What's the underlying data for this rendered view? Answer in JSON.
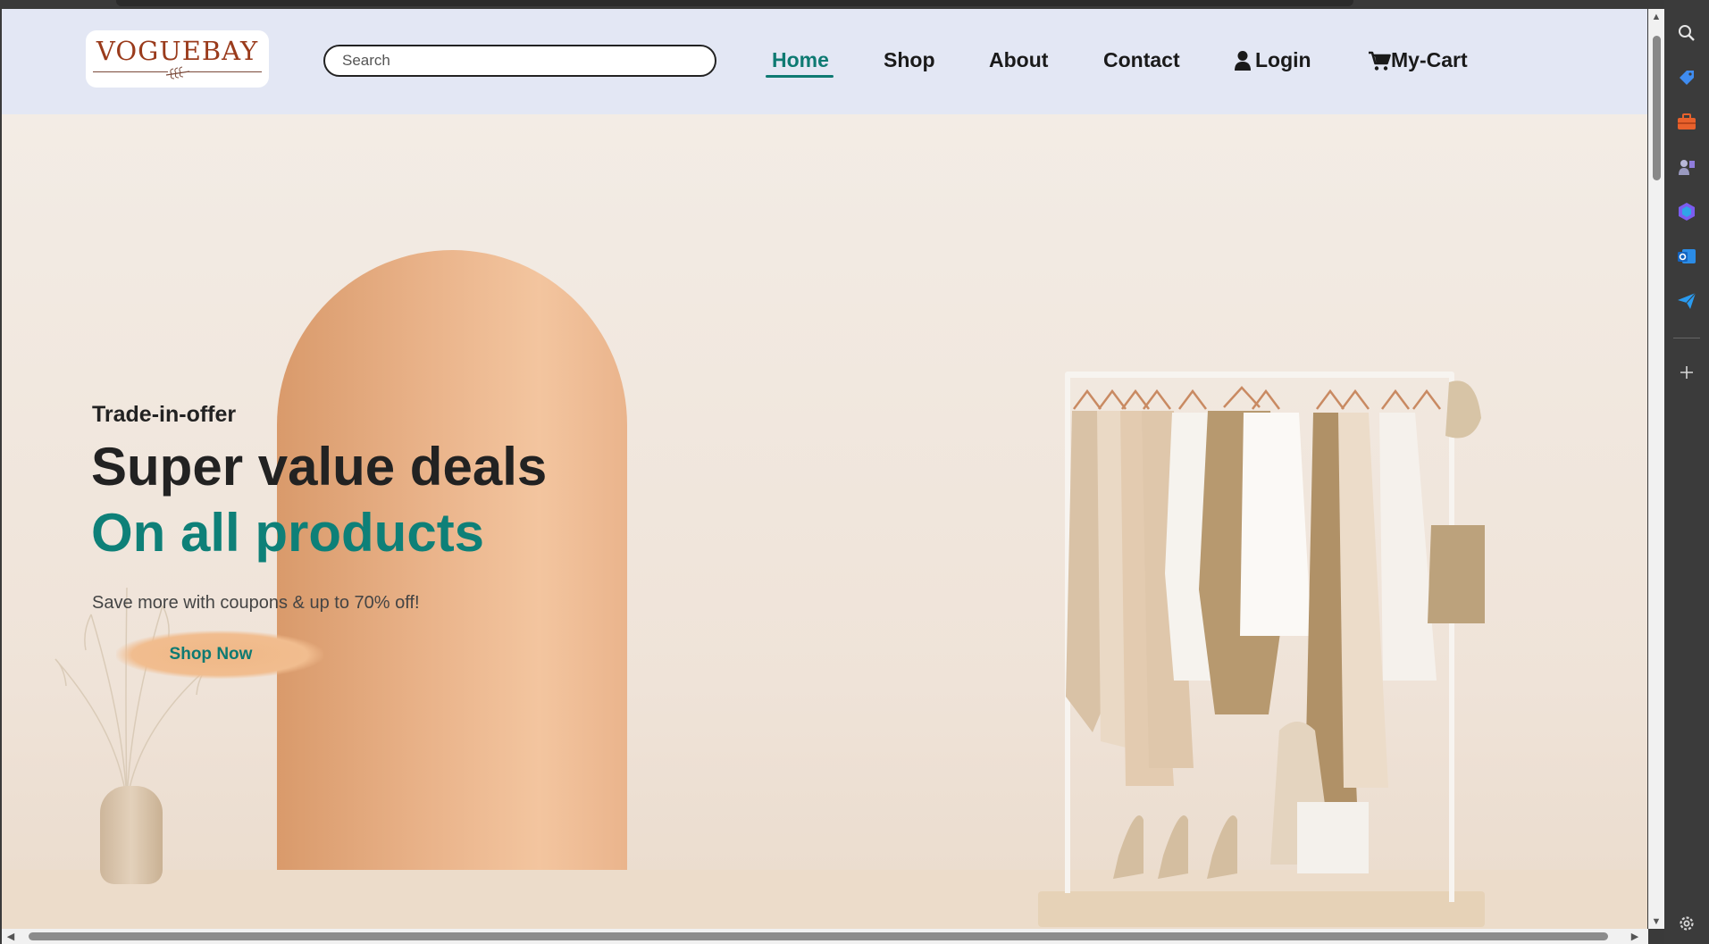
{
  "header": {
    "logo_text": "VOGUEBAY",
    "search_placeholder": "Search",
    "nav": {
      "home": "Home",
      "shop": "Shop",
      "about": "About",
      "contact": "Contact",
      "login": "Login",
      "cart": "My-Cart"
    },
    "active_item": "Home"
  },
  "hero": {
    "eyebrow": "Trade-in-offer",
    "title": "Super value deals",
    "subtitle": "On all products",
    "description": "Save more with coupons & up to 70% off!",
    "cta_label": "Shop Now"
  },
  "colors": {
    "accent": "#0e7a72",
    "header_bg": "#e3e7f4",
    "logo_text": "#9a3b1c",
    "cta_bg": "#f1bd8f"
  },
  "icons": {
    "login": "user-icon",
    "cart": "cart-icon",
    "browser_sidebar": [
      "search-icon",
      "tag-icon",
      "briefcase-icon",
      "games-icon",
      "copilot-icon",
      "outlook-icon",
      "send-icon",
      "add-icon",
      "settings-icon"
    ]
  }
}
